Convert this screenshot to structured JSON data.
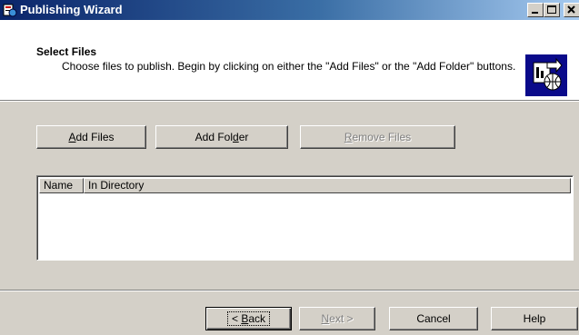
{
  "window": {
    "title": "Publishing Wizard"
  },
  "header": {
    "title": "Select Files",
    "description": "Choose files to publish.  Begin by clicking on either the \"Add Files\" or the \"Add Folder\" buttons."
  },
  "toolbar": {
    "add_files_pre": "",
    "add_files_key": "A",
    "add_files_post": "dd Files",
    "add_folder_pre": "Add Fol",
    "add_folder_key": "d",
    "add_folder_post": "er",
    "remove_files_pre": "",
    "remove_files_key": "R",
    "remove_files_post": "emove Files"
  },
  "file_list": {
    "columns": [
      "Name",
      "In Directory"
    ],
    "rows": []
  },
  "footer": {
    "back_pre": "< ",
    "back_key": "B",
    "back_post": "ack",
    "next_pre": "",
    "next_key": "N",
    "next_post": "ext >",
    "cancel": "Cancel",
    "help": "Help"
  },
  "colors": {
    "titlebar_start": "#0a246a",
    "titlebar_end": "#a6caf0",
    "face": "#d4d0c8"
  },
  "icons": [
    "app-icon",
    "minimize-icon",
    "maximize-icon",
    "close-icon",
    "publish-web-icon"
  ]
}
